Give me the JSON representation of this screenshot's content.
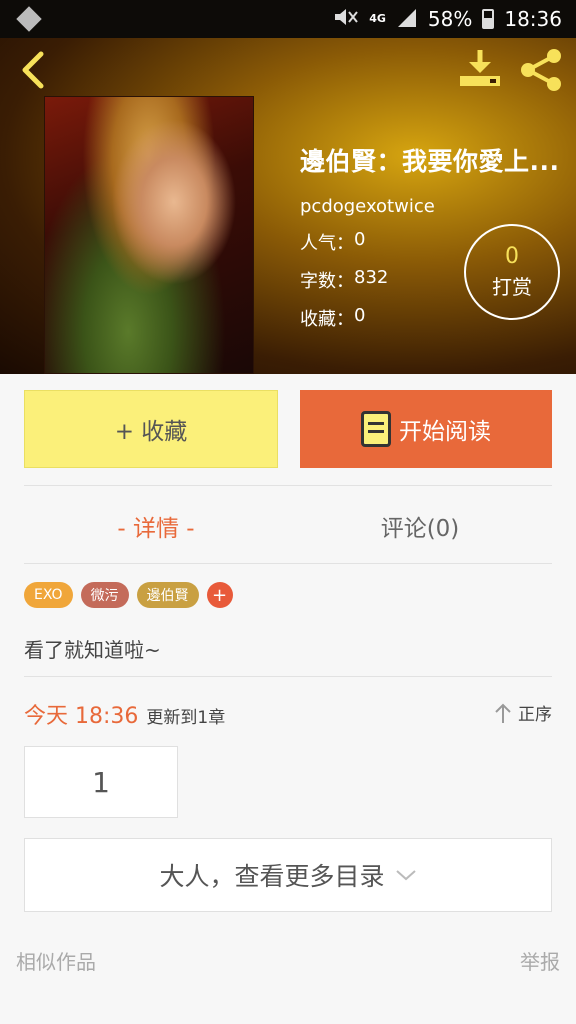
{
  "status_bar": {
    "battery": "58%",
    "time": "18:36",
    "network": "4G"
  },
  "header": {
    "back_icon": "back-chevron-icon",
    "download_icon": "download-icon",
    "share_icon": "share-icon"
  },
  "book": {
    "title": "邊伯賢：我要你愛上...",
    "author": "pcdogexotwice",
    "popularity_label": "人气：",
    "popularity": "0",
    "words_label": "字数：",
    "words": "832",
    "favorites_label": "收藏：",
    "favorites": "0"
  },
  "reward": {
    "count": "0",
    "label": "打赏"
  },
  "actions": {
    "collect_label": "+ 收藏",
    "read_label": "开始阅读"
  },
  "tabs": {
    "detail": "- 详情 -",
    "comments": "评论(0)"
  },
  "tags": [
    {
      "label": "EXO",
      "color": "#f0a63a"
    },
    {
      "label": "微污",
      "color": "#c46b5a"
    },
    {
      "label": "邊伯賢",
      "color": "#c9a042"
    }
  ],
  "tag_add_label": "+",
  "description": "看了就知道啦~",
  "update": {
    "time": "今天 18:36",
    "text": "更新到1章",
    "sort_label": "正序"
  },
  "chapters": {
    "first": "1",
    "more_label": "大人，查看更多目录"
  },
  "footer": {
    "similar_label": "相似作品",
    "report_label": "举报"
  },
  "colors": {
    "accent": "#e8693a",
    "collect_bg": "#fbf07a"
  }
}
